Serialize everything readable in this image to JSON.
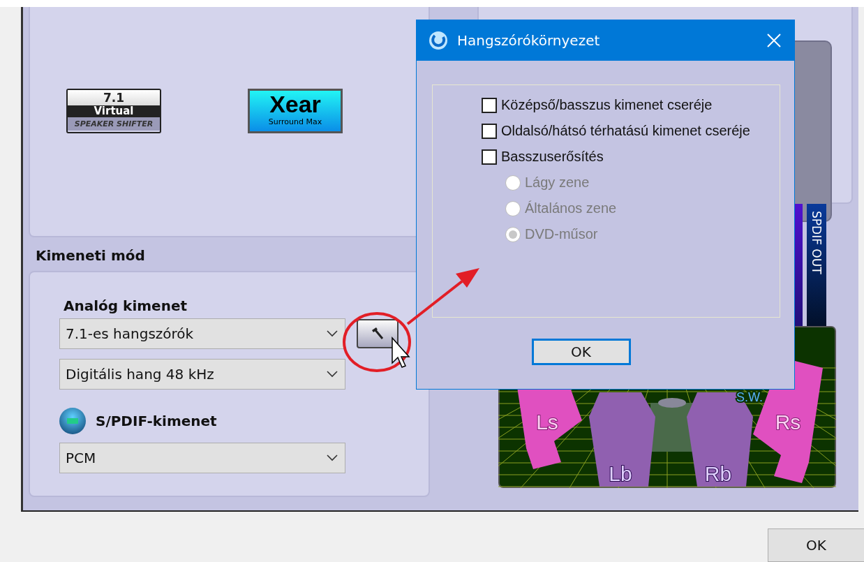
{
  "main": {
    "logos": [
      {
        "kind": "virtual",
        "lines": [
          "7.1",
          "Virtual",
          "SPEAKER SHIFTER"
        ]
      },
      {
        "kind": "xear",
        "lines": [
          "Xear",
          "Surround Max"
        ]
      }
    ],
    "output_mode": {
      "title": "Kimeneti mód",
      "analog_label": "Analóg kimenet",
      "analog_selects": [
        "7.1-es hangszórók",
        "Digitális hang 48 kHz"
      ],
      "spdif_label": "S/PDIF-kimenet",
      "spdif_select": "PCM"
    },
    "side_tabs": [
      {
        "label": "SPDIF OUT"
      }
    ],
    "speakers": [
      {
        "kind": "side",
        "label": "Ls"
      },
      {
        "kind": "back",
        "label": "Lb"
      },
      {
        "kind": "back",
        "label": "Rb"
      },
      {
        "kind": "side",
        "label": "Rs"
      },
      {
        "kind": "sub",
        "label": "S.W."
      }
    ]
  },
  "dialog": {
    "title": "Hangszórókörnyezet",
    "checkboxes": [
      {
        "label": "Középső/basszus kimenet cseréje",
        "checked": false
      },
      {
        "label": "Oldalsó/hátsó térhatású kimenet cseréje",
        "checked": false
      },
      {
        "label": "Basszuserősítés",
        "checked": false
      }
    ],
    "radios": [
      {
        "label": "Lágy zene",
        "selected": false,
        "disabled": true
      },
      {
        "label": "Általános zene",
        "selected": false,
        "disabled": true
      },
      {
        "label": "DVD-műsor",
        "selected": true,
        "disabled": true
      }
    ],
    "ok": "OK"
  },
  "footer": {
    "ok": "OK"
  }
}
